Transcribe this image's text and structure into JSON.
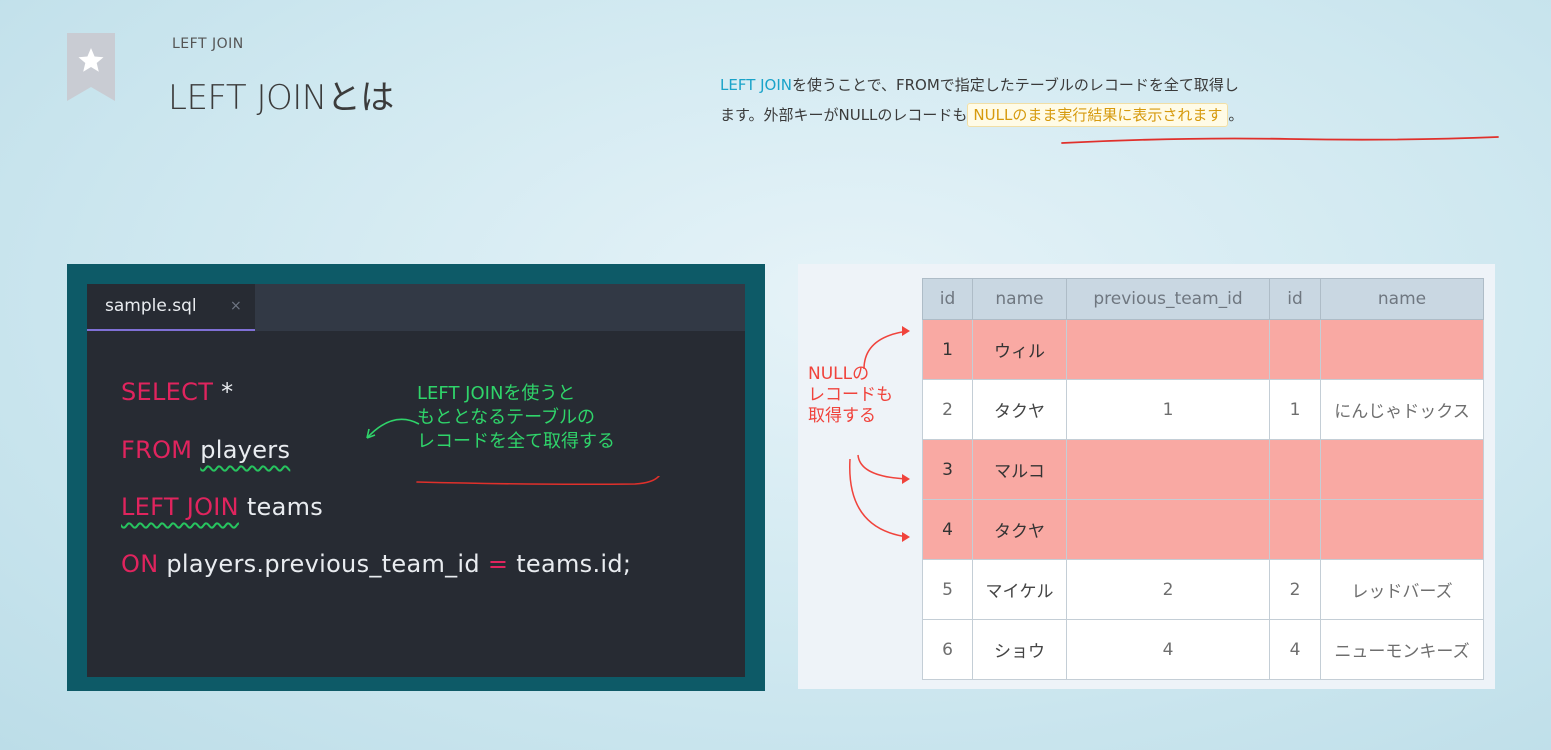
{
  "header": {
    "kicker": "LEFT JOIN",
    "title": "LEFT JOINとは",
    "icon": "star-bookmark-icon"
  },
  "description": {
    "part1": "LEFT JOIN",
    "part2": "を使うことで、FROMで指定したテーブルのレコードを全て取得し",
    "part3": "ます。外部キーがNULLのレコードも",
    "part4": "NULLのまま実行結果に表示されます",
    "part5": "。"
  },
  "editor": {
    "tab_label": "sample.sql",
    "close_glyph": "×",
    "lines": [
      {
        "kw": "SELECT",
        "rest": " *"
      },
      {
        "kw": "FROM",
        "rest": "players"
      },
      {
        "kw": "LEFT JOIN",
        "rest": " teams"
      },
      {
        "kw": "ON",
        "op": "=",
        "rest_a": " players.previous_team_id ",
        "rest_b": " teams.id;"
      }
    ],
    "note": "LEFT JOINを使うと\nもととなるテーブルの\nレコードを全て取得する"
  },
  "annotation": "NULLの\nレコードも\n取得する",
  "result_table": {
    "columns": [
      "id",
      "name",
      "previous_team_id",
      "id",
      "name"
    ],
    "rows": [
      {
        "cells": [
          "1",
          "ウィル",
          "",
          "",
          ""
        ],
        "null": true
      },
      {
        "cells": [
          "2",
          "タクヤ",
          "1",
          "1",
          "にんじゃドックス"
        ],
        "null": false
      },
      {
        "cells": [
          "3",
          "マルコ",
          "",
          "",
          ""
        ],
        "null": true
      },
      {
        "cells": [
          "4",
          "タクヤ",
          "",
          "",
          ""
        ],
        "null": true
      },
      {
        "cells": [
          "5",
          "マイケル",
          "2",
          "2",
          "レッドバーズ"
        ],
        "null": false
      },
      {
        "cells": [
          "6",
          "ショウ",
          "4",
          "4",
          "ニューモンキーズ"
        ],
        "null": false
      }
    ]
  },
  "colors": {
    "accent_blue": "#1aa3c9",
    "highlight_text": "#d69a0e",
    "keyword": "#e0245e",
    "note_green": "#2fd46a",
    "annotation_red": "#f0433c",
    "null_row": "#f9a9a3"
  }
}
